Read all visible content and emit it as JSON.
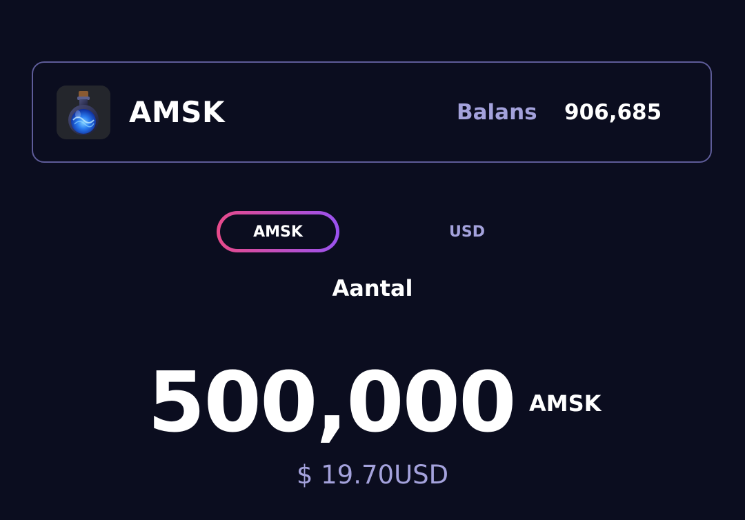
{
  "token": {
    "name": "AMSK",
    "icon": "potion-flask-icon",
    "balance_label": "Balans",
    "balance_value": "906,685"
  },
  "toggle": {
    "options": [
      {
        "label": "AMSK",
        "active": true
      },
      {
        "label": "USD",
        "active": false
      }
    ]
  },
  "amount": {
    "caption": "Aantal",
    "value": "500,000",
    "unit": "AMSK",
    "usd_equivalent": "$ 19.70USD"
  },
  "colors": {
    "background": "#0b0d1f",
    "card_border": "#5e5c99",
    "muted_text": "#a4a2dc",
    "toggle_gradient_start": "#e84a8a",
    "toggle_gradient_end": "#9a52f0"
  }
}
